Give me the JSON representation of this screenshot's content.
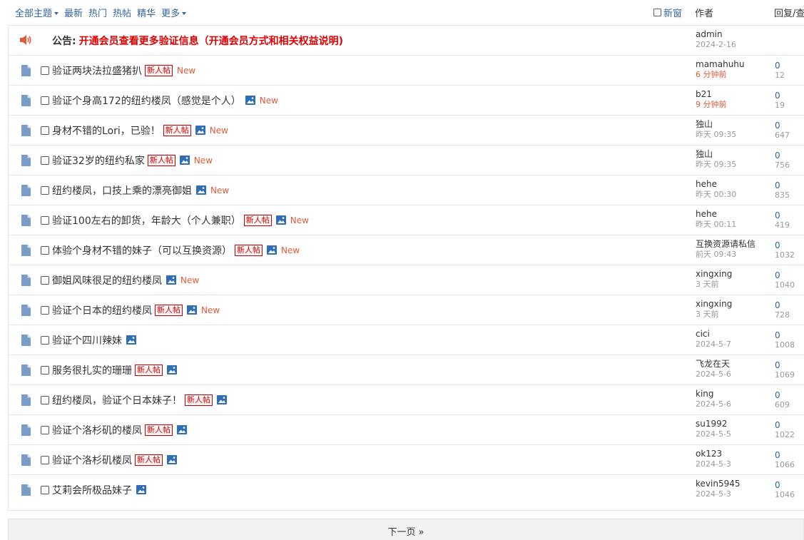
{
  "filters": {
    "all_topics": "全部主题",
    "latest": "最新",
    "hot": "热门",
    "hot_posts": "热帖",
    "digest": "精华",
    "more": "更多"
  },
  "header": {
    "new_window": "新窗",
    "author": "作者",
    "reply_view": "回复/查看"
  },
  "announcement": {
    "label": "公告:",
    "text": "开通会员查看更多验证信息（开通会员方式和相关权益说明)",
    "author": "admin",
    "date": "2024-2-16"
  },
  "threads": [
    {
      "title": "验证两块法拉盛猪扒",
      "newbie": true,
      "image": false,
      "is_new": true,
      "author": "mamahuhu",
      "time": "6 分钟前",
      "recent": true,
      "replies": "0",
      "views": "12"
    },
    {
      "title": "验证个身高172的纽约楼凤（感觉是个人）",
      "newbie": false,
      "image": true,
      "is_new": true,
      "author": "b21",
      "time": "9 分钟前",
      "recent": true,
      "replies": "0",
      "views": "19"
    },
    {
      "title": "身材不错的Lori，已验！",
      "newbie": true,
      "image": true,
      "is_new": true,
      "author": "独山",
      "time": "昨天 09:35",
      "recent": false,
      "replies": "0",
      "views": "647"
    },
    {
      "title": "验证32岁的纽约私家",
      "newbie": true,
      "image": true,
      "is_new": true,
      "author": "独山",
      "time": "昨天 09:35",
      "recent": false,
      "replies": "0",
      "views": "756"
    },
    {
      "title": "纽约楼凤，口技上乘的漂亮御姐",
      "newbie": false,
      "image": true,
      "is_new": true,
      "author": "hehe",
      "time": "昨天 00:30",
      "recent": false,
      "replies": "0",
      "views": "835"
    },
    {
      "title": "验证100左右的卸货，年龄大（个人兼职）",
      "newbie": true,
      "image": true,
      "is_new": true,
      "author": "hehe",
      "time": "昨天 00:11",
      "recent": false,
      "replies": "0",
      "views": "419"
    },
    {
      "title": "体验个身材不错的妹子（可以互换资源）",
      "newbie": true,
      "image": true,
      "is_new": true,
      "author": "互换资源请私信",
      "time": "前天 09:43",
      "recent": false,
      "replies": "0",
      "views": "1032"
    },
    {
      "title": "御姐风味很足的纽约楼凤",
      "newbie": false,
      "image": true,
      "is_new": true,
      "author": "xingxing",
      "time": "3 天前",
      "recent": false,
      "replies": "0",
      "views": "1040"
    },
    {
      "title": "验证个日本的纽约楼凤",
      "newbie": true,
      "image": true,
      "is_new": true,
      "author": "xingxing",
      "time": "3 天前",
      "recent": false,
      "replies": "0",
      "views": "728"
    },
    {
      "title": "验证个四川辣妹",
      "newbie": false,
      "image": true,
      "is_new": false,
      "author": "cici",
      "time": "2024-5-7",
      "recent": false,
      "replies": "0",
      "views": "1008"
    },
    {
      "title": "服务很扎实的珊珊",
      "newbie": true,
      "image": true,
      "is_new": false,
      "author": "飞龙在天",
      "time": "2024-5-6",
      "recent": false,
      "replies": "0",
      "views": "1069"
    },
    {
      "title": "纽约楼凤，验证个日本妹子！",
      "newbie": true,
      "image": true,
      "is_new": false,
      "author": "king",
      "time": "2024-5-6",
      "recent": false,
      "replies": "0",
      "views": "609"
    },
    {
      "title": "验证个洛杉矶的楼凤",
      "newbie": true,
      "image": true,
      "is_new": false,
      "author": "su1992",
      "time": "2024-5-5",
      "recent": false,
      "replies": "0",
      "views": "1022"
    },
    {
      "title": "验证个洛杉矶楼凤",
      "newbie": true,
      "image": true,
      "is_new": false,
      "author": "ok123",
      "time": "2024-5-3",
      "recent": false,
      "replies": "0",
      "views": "1066"
    },
    {
      "title": "艾莉会所极品妹子",
      "newbie": false,
      "image": true,
      "is_new": false,
      "author": "kevin5945",
      "time": "2024-5-3",
      "recent": false,
      "replies": "0",
      "views": "1046"
    }
  ],
  "labels": {
    "newbie_badge": "新人帖",
    "new_marker": "New"
  },
  "icons": {
    "announcement": "speaker-icon",
    "thread": "document-icon",
    "attachment": "image-icon"
  },
  "colors": {
    "link": "#336699",
    "announcement": "#e00000",
    "new_marker": "#e05a3a",
    "doc_icon": "#7a9cc9",
    "image_icon": "#2f6db5"
  },
  "pager": {
    "next": "下一页 »"
  }
}
